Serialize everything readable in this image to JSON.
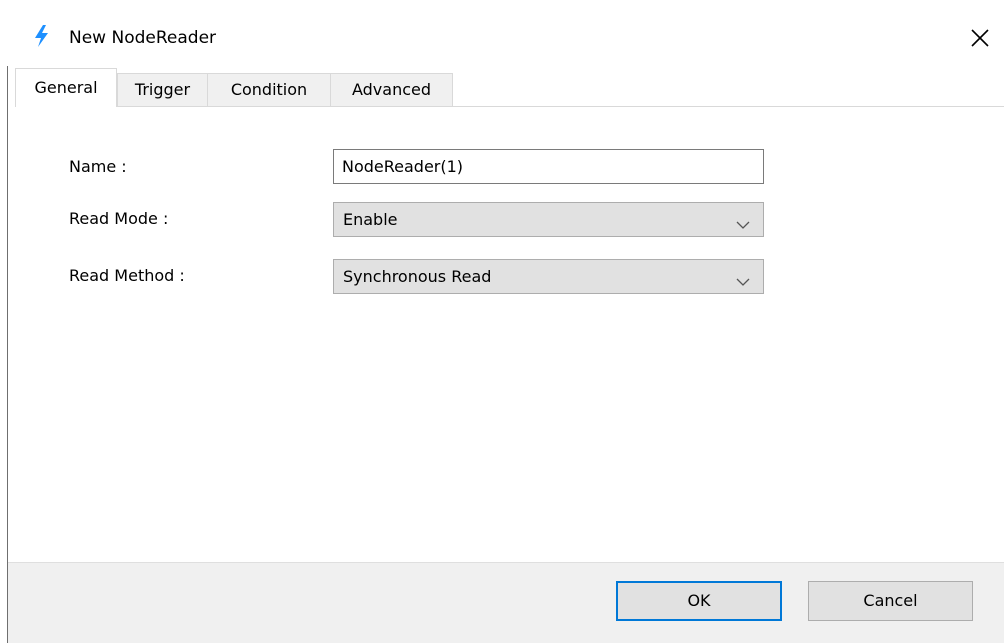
{
  "window": {
    "title": "New NodeReader",
    "accent_color": "#0078d7"
  },
  "tabs": [
    {
      "label": "General",
      "active": true
    },
    {
      "label": "Trigger",
      "active": false
    },
    {
      "label": "Condition",
      "active": false
    },
    {
      "label": "Advanced",
      "active": false
    }
  ],
  "form": {
    "name_label": "Name :",
    "name_value": "NodeReader(1)",
    "read_mode_label": "Read Mode :",
    "read_mode_value": "Enable",
    "read_method_label": "Read Method :",
    "read_method_value": "Synchronous Read"
  },
  "footer": {
    "ok_label": "OK",
    "cancel_label": "Cancel"
  },
  "icons": {
    "app_icon": "lightning-bolt-icon",
    "close_icon": "close-icon",
    "dropdown_icon": "chevron-down-icon"
  }
}
